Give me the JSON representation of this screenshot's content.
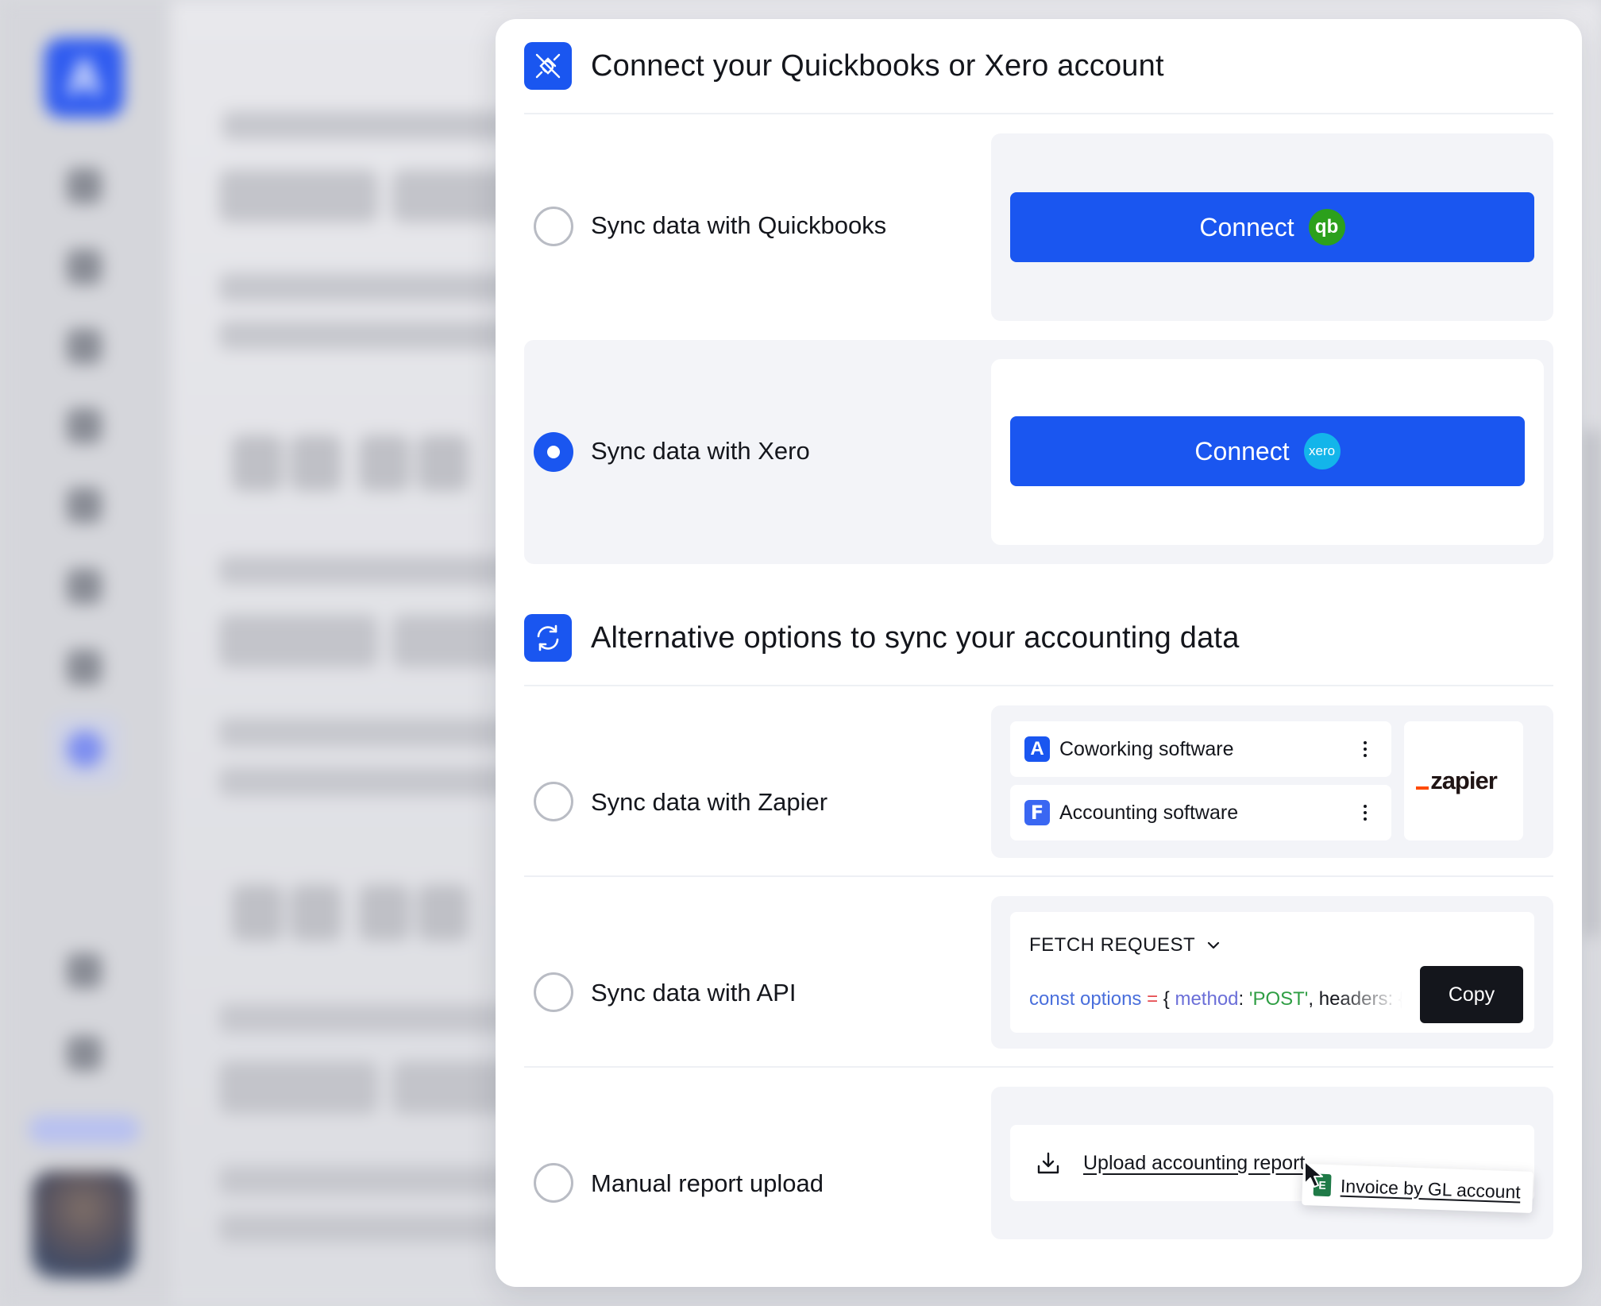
{
  "background": {
    "logo_letter": "A"
  },
  "connect_section": {
    "title": "Connect your Quickbooks or Xero account",
    "icon": "plug-disconnected-icon",
    "options": [
      {
        "label": "Sync data with Quickbooks",
        "selected": false,
        "button_label": "Connect",
        "brand_icon": "quickbooks-logo-icon",
        "brand_text": "qb",
        "brand_color": "#2ca01c"
      },
      {
        "label": "Sync data with Xero",
        "selected": true,
        "button_label": "Connect",
        "brand_icon": "xero-logo-icon",
        "brand_text": "xero",
        "brand_color": "#13b5ea"
      }
    ]
  },
  "alternative_section": {
    "title": "Alternative options to sync your accounting data",
    "icon": "sync-arrows-icon",
    "zapier": {
      "label": "Sync data with Zapier",
      "selected": false,
      "apps": [
        {
          "letter": "A",
          "label": "Coworking software"
        },
        {
          "letter": "F",
          "label": "Accounting software"
        }
      ],
      "logo_text": "zapier"
    },
    "api": {
      "label": "Sync data with API",
      "selected": false,
      "request_type": "FETCH REQUEST",
      "code": {
        "kw": "const options",
        "op": " = ",
        "open": "{ ",
        "prop": "method",
        "colon": ": ",
        "str": "'POST'",
        "rest": ", headers: { }"
      },
      "copy_label": "Copy"
    },
    "manual": {
      "label": "Manual report upload",
      "upload_label": "Upload accounting report",
      "dragged_file": "Invoice by GL account",
      "file_icon_letter": "E"
    }
  },
  "colors": {
    "accent": "#1a56f0",
    "dark_button": "#14161c"
  }
}
